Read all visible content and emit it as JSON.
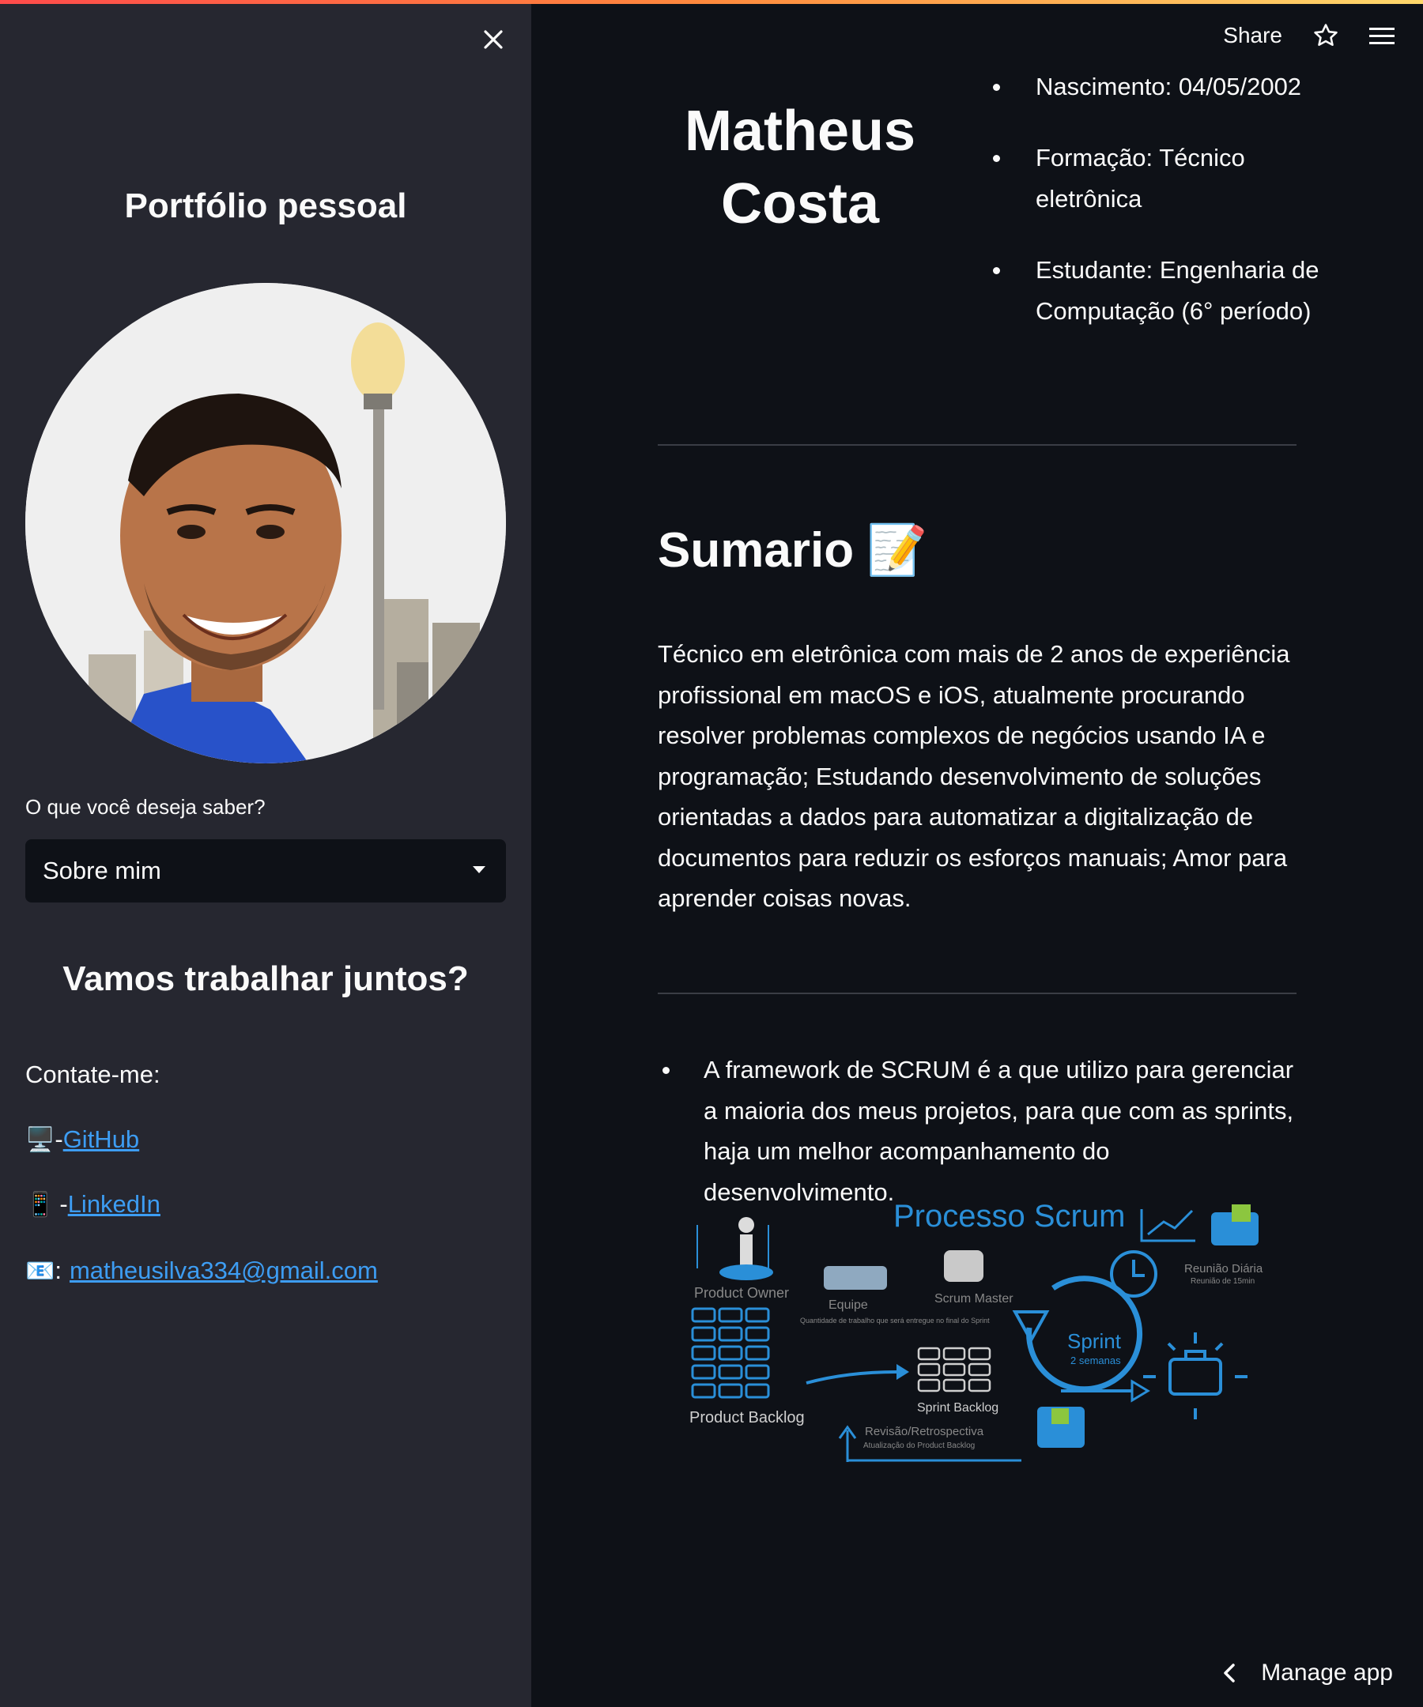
{
  "header": {
    "share_label": "Share"
  },
  "sidebar": {
    "title": "Portfólio pessoal",
    "select_label": "O que você deseja saber?",
    "select_value": "Sobre mim",
    "subtitle": "Vamos trabalhar juntos?",
    "contact_label": "Contate-me:",
    "contacts": [
      {
        "icon": "computer-icon",
        "prefix": "-",
        "text": "GitHub"
      },
      {
        "icon": "mobile-phone-icon",
        "prefix": "-",
        "text": "LinkedIn"
      },
      {
        "icon": "email-icon",
        "prefix": ":",
        "text": "matheusilva334@gmail.com"
      }
    ]
  },
  "main": {
    "name_line1": "Matheus",
    "name_line2": "Costa",
    "info": [
      "Nascimento: 04/05/2002",
      "Formação: Técnico eletrônica",
      "Estudante: Engenharia de Computação (6° período)"
    ],
    "summary_title": "Sumario",
    "summary_text": "Técnico em eletrônica com mais de 2 anos de experiência profissional em macOS e iOS, atualmente procurando resolver problemas complexos de negócios usando IA e programação; Estudando desenvolvimento de soluções orientadas a dados para automatizar a digitalização de documentos para reduzir os esforços manuais; Amor para aprender coisas novas.",
    "scrum_text": "A framework de SCRUM é a que utilizo para gerenciar a maioria dos meus projetos, para que com as sprints, haja um melhor acompanhamento do desenvolvimento.",
    "scrum_figure": {
      "title": "Processo Scrum",
      "product_owner": "Product Owner",
      "scrum_master": "Scrum Master",
      "equipe": "Equipe",
      "equipe_sub": "Quantidade de trabalho que será entregue no final do Sprint",
      "product_backlog": "Product Backlog",
      "sprint_backlog": "Sprint Backlog",
      "sprint": "Sprint",
      "sprint_sub": "2 semanas",
      "reuniao": "Reunião Diária",
      "reuniao_sub": "Reunião de 15min",
      "revisao": "Revisão/Retrospectiva",
      "revisao_sub": "Atualização do Product Backlog"
    }
  },
  "footer": {
    "manage_app": "Manage app"
  },
  "colors": {
    "background": "#0e1117",
    "sidebar": "#262730",
    "link": "#3d9df3",
    "accent": "#ff4b4b",
    "scrum_blue": "#2a8fd8"
  }
}
